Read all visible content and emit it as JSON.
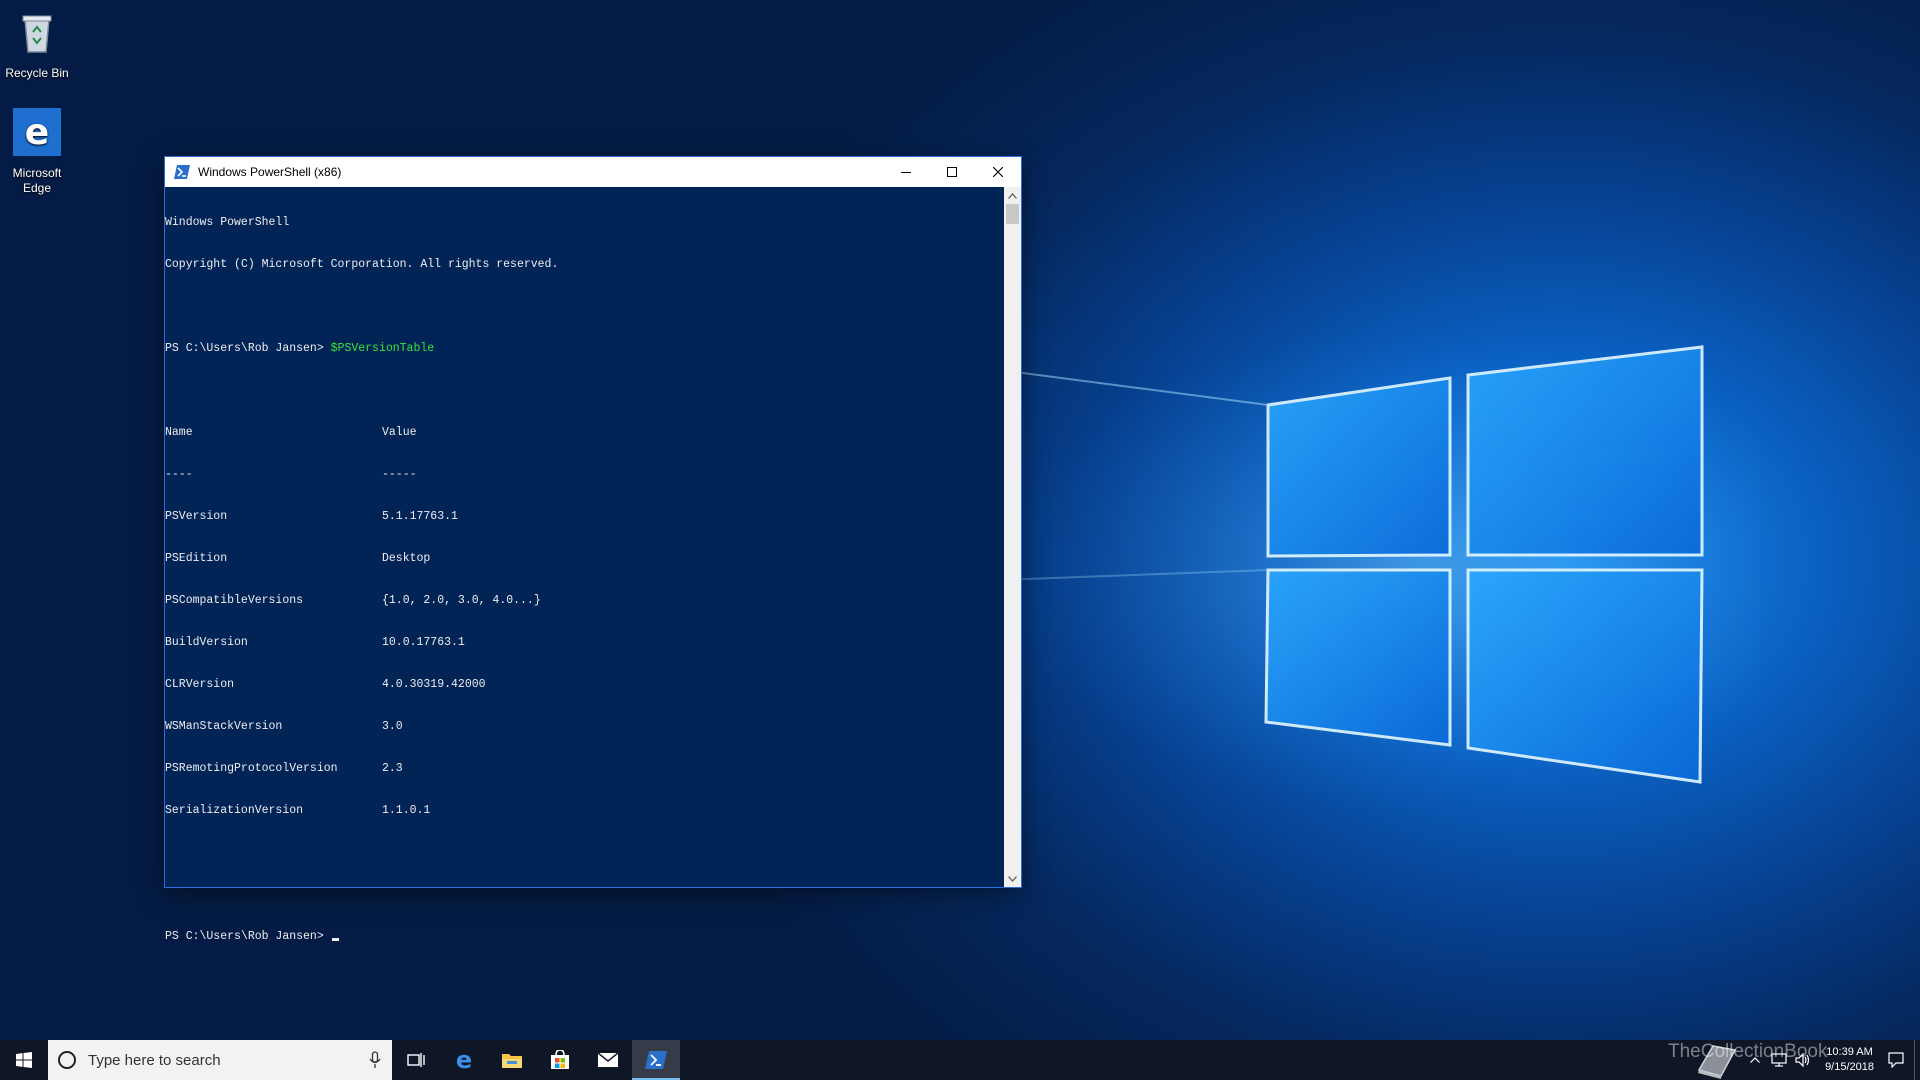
{
  "desktop": {
    "icons": [
      {
        "label": "Recycle Bin",
        "icon": "recycle-bin-icon"
      },
      {
        "label": "Microsoft Edge",
        "icon": "edge-icon"
      }
    ]
  },
  "window": {
    "title": "Windows PowerShell (x86)",
    "icon": "powershell-icon",
    "controls": [
      "minimize-icon",
      "maximize-icon",
      "close-icon"
    ],
    "console": {
      "banner": [
        "Windows PowerShell",
        "Copyright (C) Microsoft Corporation. All rights reserved."
      ],
      "prompt": "PS C:\\Users\\Rob Jansen>",
      "command": "$PSVersionTable",
      "table_headers": [
        "Name",
        "Value"
      ],
      "table_underline": [
        "----",
        "-----"
      ],
      "table_rows": [
        [
          "PSVersion",
          "5.1.17763.1"
        ],
        [
          "PSEdition",
          "Desktop"
        ],
        [
          "PSCompatibleVersions",
          "{1.0, 2.0, 3.0, 4.0...}"
        ],
        [
          "BuildVersion",
          "10.0.17763.1"
        ],
        [
          "CLRVersion",
          "4.0.30319.42000"
        ],
        [
          "WSManStackVersion",
          "3.0"
        ],
        [
          "PSRemotingProtocolVersion",
          "2.3"
        ],
        [
          "SerializationVersion",
          "1.1.0.1"
        ]
      ],
      "final_prompt": "PS C:\\Users\\Rob Jansen>"
    },
    "colors": {
      "console_bg": "#012456",
      "command_fg": "#3ce23c"
    }
  },
  "taskbar": {
    "search_placeholder": "Type here to search",
    "apps": [
      "task-view-icon",
      "edge-icon",
      "file-explorer-icon",
      "store-icon",
      "mail-icon",
      "powershell-icon"
    ],
    "active_app": "powershell-icon",
    "clock_time": "10:39 AM",
    "clock_date": "9/15/2018"
  },
  "watermark": "TheCollectionBook"
}
